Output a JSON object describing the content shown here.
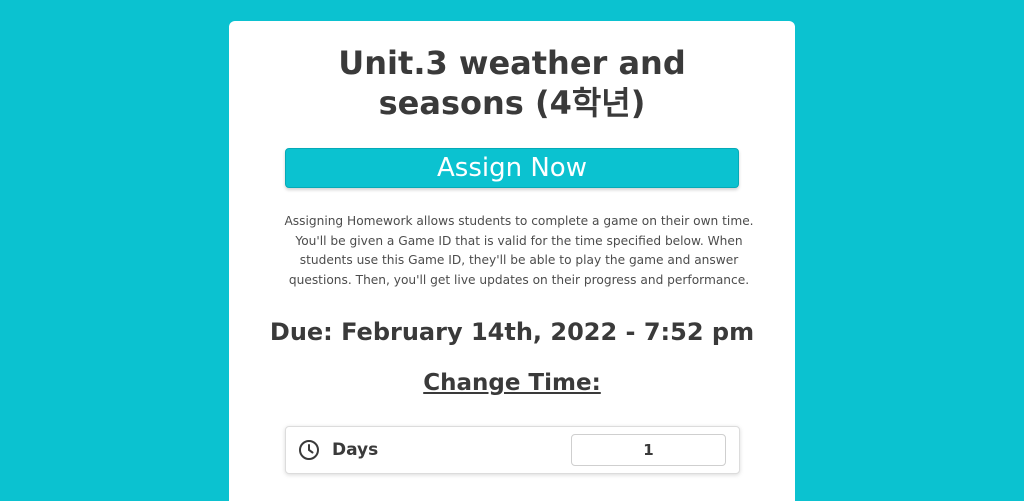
{
  "page": {
    "title": "Unit.3 weather and seasons (4학년)",
    "assign_button_label": "Assign Now",
    "description": "Assigning Homework allows students to complete a game on their own time. You'll be given a Game ID that is valid for the time specified below. When students use this Game ID, they'll be able to play the game and answer questions. Then, you'll get live updates on their progress and performance.",
    "due_text": "Due: February 14th, 2022 - 7:52 pm",
    "change_time_heading": "Change Time:"
  },
  "time_settings": {
    "days": {
      "label": "Days",
      "value": "1",
      "icon": "clock-icon"
    }
  },
  "colors": {
    "background": "#0bc2d0",
    "accent": "#0bc2d0",
    "card": "#ffffff",
    "text": "#3a3a3a"
  }
}
